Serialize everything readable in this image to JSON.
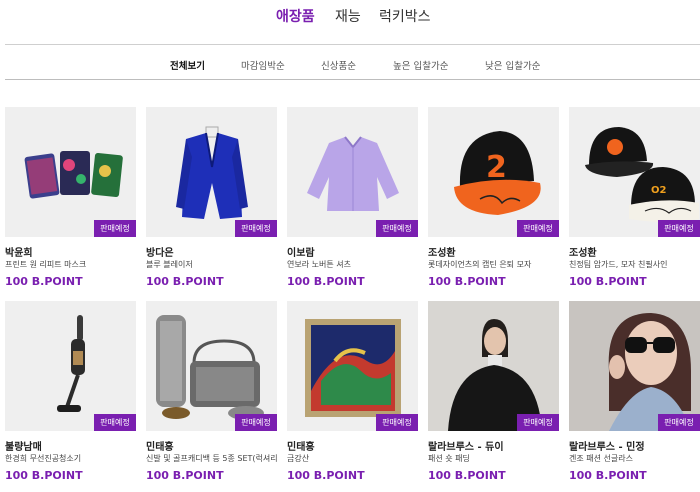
{
  "top_tabs": [
    {
      "label": "애장품",
      "active": true
    },
    {
      "label": "재능",
      "active": false
    },
    {
      "label": "럭키박스",
      "active": false
    }
  ],
  "sub_tabs": [
    {
      "label": "전체보기",
      "active": true
    },
    {
      "label": "마감임박순",
      "active": false
    },
    {
      "label": "신상품순",
      "active": false
    },
    {
      "label": "높은 입찰가순",
      "active": false
    },
    {
      "label": "낮은 입찰가순",
      "active": false
    }
  ],
  "colors": {
    "accent": "#7a1fb0",
    "thumb_bg": "#efefef"
  },
  "products": [
    {
      "name": "박윤희",
      "desc": "프린트 원 리피트 마스크",
      "price": "100 B.POINT",
      "badge": "판매예정",
      "image": "masks-photo"
    },
    {
      "name": "방다은",
      "desc": "블루 블레이저",
      "price": "100 B.POINT",
      "badge": "판매예정",
      "image": "blue-blazer-photo"
    },
    {
      "name": "이보람",
      "desc": "연보라 노버튼 셔츠",
      "price": "100 B.POINT",
      "badge": "판매예정",
      "image": "lavender-shirt-photo"
    },
    {
      "name": "조성환",
      "desc": "롯데자이언츠의 캡틴 은퇴 모자",
      "price": "100 B.POINT",
      "badge": "판매예정",
      "image": "signed-cap-photo"
    },
    {
      "name": "조성환",
      "desc": "친정팀 암가드, 모자 친필사인",
      "price": "100 B.POINT",
      "badge": "판매예정",
      "image": "signed-caps-photo"
    },
    {
      "name": "불량남매",
      "desc": "한경희 무선진공청소기",
      "price": "100 B.POINT",
      "badge": "판매예정",
      "image": "vacuum-photo"
    },
    {
      "name": "민태홍",
      "desc": "신발 및 골프캐디백 등 5종 SET(럭셔리)",
      "price": "100 B.POINT",
      "badge": "판매예정",
      "image": "golf-bag-set-photo"
    },
    {
      "name": "민태홍",
      "desc": "금강산",
      "price": "100 B.POINT",
      "badge": "판매예정",
      "image": "painting-photo"
    },
    {
      "name": "랄라브루스 - 듀이",
      "desc": "패션 숏 패딩",
      "price": "100 B.POINT",
      "badge": "판매예정",
      "image": "short-padding-photo"
    },
    {
      "name": "랄라브루스 - 민정",
      "desc": "겐조 패션 선글라스",
      "price": "100 B.POINT",
      "badge": "판매예정",
      "image": "sunglasses-photo"
    }
  ]
}
